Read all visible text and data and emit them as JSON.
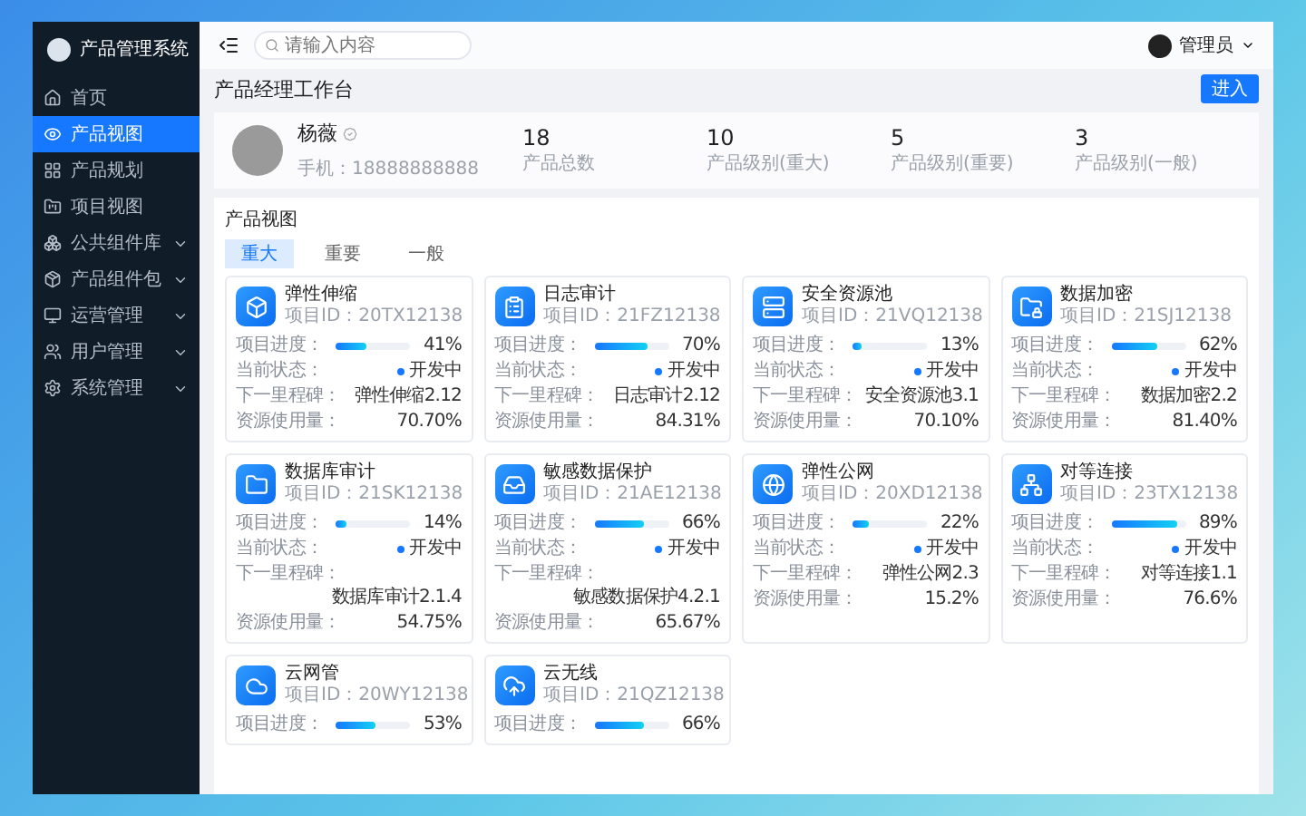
{
  "sidebar": {
    "title": "产品管理系统",
    "items": [
      {
        "label": "首页",
        "selected": false,
        "expandable": false
      },
      {
        "label": "产品视图",
        "selected": true,
        "expandable": false
      },
      {
        "label": "产品规划",
        "selected": false,
        "expandable": false
      },
      {
        "label": "项目视图",
        "selected": false,
        "expandable": false
      },
      {
        "label": "公共组件库",
        "selected": false,
        "expandable": true
      },
      {
        "label": "产品组件包",
        "selected": false,
        "expandable": true
      },
      {
        "label": "运营管理",
        "selected": false,
        "expandable": true
      },
      {
        "label": "用户管理",
        "selected": false,
        "expandable": true
      },
      {
        "label": "系统管理",
        "selected": false,
        "expandable": true
      }
    ]
  },
  "header": {
    "search": {
      "placeholder": "请输入内容"
    },
    "user": "管理员"
  },
  "page": {
    "title": "产品经理工作台",
    "action": "进入"
  },
  "profile": {
    "name": "杨薇",
    "phone": "手机：18888888888",
    "stats": [
      {
        "value": "18",
        "label": "产品总数"
      },
      {
        "value": "10",
        "label": "产品级别(重大)"
      },
      {
        "value": "5",
        "label": "产品级别(重要)"
      },
      {
        "value": "3",
        "label": "产品级别(一般)"
      }
    ]
  },
  "panel": {
    "title": "产品视图",
    "tabs": [
      {
        "label": "重大",
        "selected": true
      },
      {
        "label": "重要",
        "selected": false
      },
      {
        "label": "一般",
        "selected": false
      }
    ],
    "cards": [
      {
        "name": "弹性伸缩",
        "id": "项目ID：20TX12138",
        "progress_label": "项目进度：",
        "level": 0.41,
        "percent": "41%",
        "status_label": "当前状态：",
        "status": "开发中",
        "milestone_label": "下一里程碑：",
        "milestone": "弹性伸缩2.12",
        "usage_label": "资源使用量：",
        "usage": "70.70%"
      },
      {
        "name": "日志审计",
        "id": "项目ID：21FZ12138",
        "progress_label": "项目进度：",
        "level": 0.7,
        "percent": "70%",
        "status_label": "当前状态：",
        "status": "开发中",
        "milestone_label": "下一里程碑：",
        "milestone": "日志审计2.12",
        "usage_label": "资源使用量：",
        "usage": "84.31%"
      },
      {
        "name": "安全资源池",
        "id": "项目ID：21VQ12138",
        "progress_label": "项目进度：",
        "level": 0.13,
        "percent": "13%",
        "status_label": "当前状态：",
        "status": "开发中",
        "milestone_label": "下一里程碑：",
        "milestone": "安全资源池3.1",
        "usage_label": "资源使用量：",
        "usage": "70.10%"
      },
      {
        "name": "数据加密",
        "id": "项目ID：21SJ12138",
        "progress_label": "项目进度：",
        "level": 0.62,
        "percent": "62%",
        "status_label": "当前状态：",
        "status": "开发中",
        "milestone_label": "下一里程碑：",
        "milestone": "数据加密2.2",
        "usage_label": "资源使用量：",
        "usage": "81.40%"
      },
      {
        "name": "数据库审计",
        "id": "项目ID：21SK12138",
        "progress_label": "项目进度：",
        "level": 0.14,
        "percent": "14%",
        "status_label": "当前状态：",
        "status": "开发中",
        "milestone_label": "下一里程碑：",
        "milestone": "数据库审计2.1.4",
        "usage_label": "资源使用量：",
        "usage": "54.75%"
      },
      {
        "name": "敏感数据保护",
        "id": "项目ID：21AE12138",
        "progress_label": "项目进度：",
        "level": 0.66,
        "percent": "66%",
        "status_label": "当前状态：",
        "status": "开发中",
        "milestone_label": "下一里程碑：",
        "milestone": "敏感数据保护4.2.1",
        "usage_label": "资源使用量：",
        "usage": "65.67%"
      },
      {
        "name": "弹性公网",
        "id": "项目ID：20XD12138",
        "progress_label": "项目进度：",
        "level": 0.22,
        "percent": "22%",
        "status_label": "当前状态：",
        "status": "开发中",
        "milestone_label": "下一里程碑：",
        "milestone": "弹性公网2.3",
        "usage_label": "资源使用量：",
        "usage": "15.2%"
      },
      {
        "name": "对等连接",
        "id": "项目ID：23TX12138",
        "progress_label": "项目进度：",
        "level": 0.89,
        "percent": "89%",
        "status_label": "当前状态：",
        "status": "开发中",
        "milestone_label": "下一里程碑：",
        "milestone": "对等连接1.1",
        "usage_label": "资源使用量：",
        "usage": "76.6%"
      },
      {
        "name": "云网管",
        "id": "项目ID：20WY12138",
        "progress_label": "项目进度：",
        "level": 0.53,
        "percent": "53%"
      },
      {
        "name": "云无线",
        "id": "项目ID：21QZ12138",
        "progress_label": "项目进度：",
        "level": 0.66,
        "percent": "66%"
      }
    ]
  }
}
